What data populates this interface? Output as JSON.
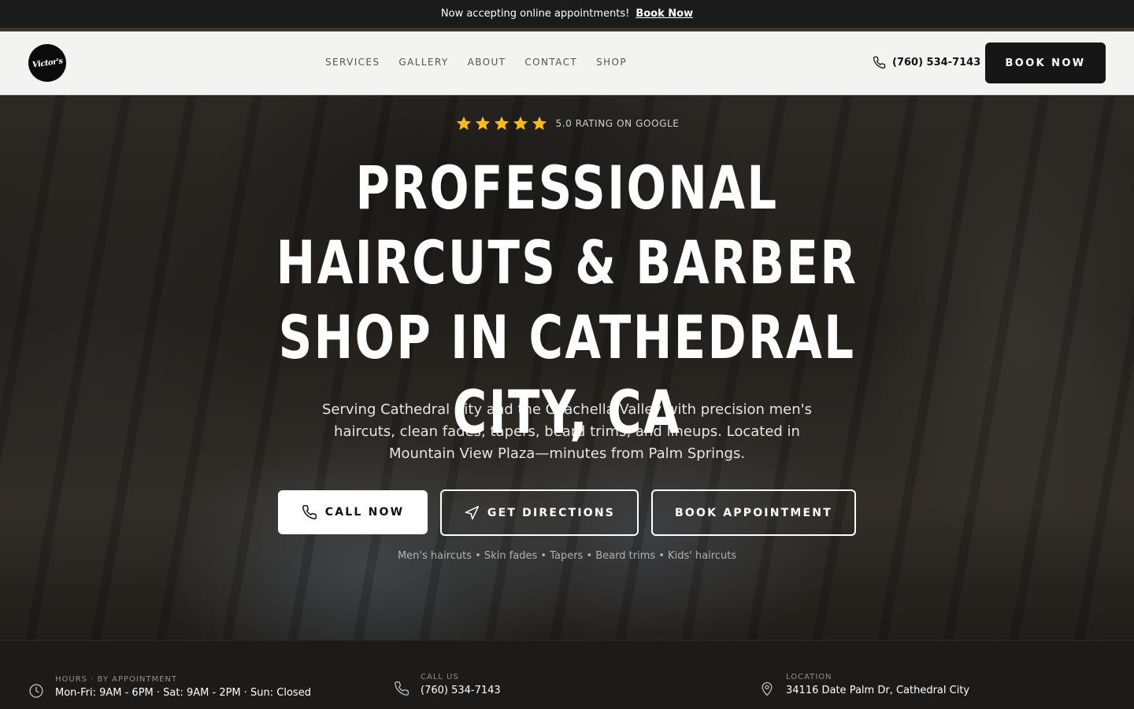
{
  "announcement": {
    "text": "Now accepting online appointments!",
    "link": "Book Now"
  },
  "header": {
    "logo_text": "Victor's",
    "nav": [
      "SERVICES",
      "GALLERY",
      "ABOUT",
      "CONTACT",
      "SHOP"
    ],
    "phone": "(760) 534-7143",
    "book_label": "BOOK NOW"
  },
  "hero": {
    "rating_stars": 5,
    "rating_text": "5.0 RATING ON GOOGLE",
    "title": "PROFESSIONAL HAIRCUTS & BARBER SHOP IN CATHEDRAL CITY, CA",
    "subtitle": "Serving Cathedral City and the Coachella Valley with precision men's haircuts, clean fades, tapers, beard trims, and lineups. Located in Mountain View Plaza—minutes from Palm Springs.",
    "buttons": {
      "call": "CALL NOW",
      "directions": "GET DIRECTIONS",
      "book": "BOOK APPOINTMENT"
    },
    "tags": "Men's haircuts • Skin fades • Tapers • Beard trims • Kids' haircuts"
  },
  "info_bar": {
    "hours": {
      "label": "HOURS · BY APPOINTMENT",
      "value": "Mon-Fri: 9AM - 6PM · Sat: 9AM - 2PM · Sun: Closed"
    },
    "call": {
      "label": "CALL US",
      "value": "(760) 534-7143"
    },
    "location": {
      "label": "LOCATION",
      "value": "34116 Date Palm Dr, Cathedral City"
    }
  },
  "colors": {
    "announcement_bg": "#1b1b1b",
    "header_bg": "#f3f3f2",
    "button_dark": "#161616",
    "star": "#f5b921"
  },
  "icons": [
    "phone-icon",
    "star-icon",
    "navigation-arrow-icon",
    "clock-icon",
    "map-pin-icon"
  ]
}
